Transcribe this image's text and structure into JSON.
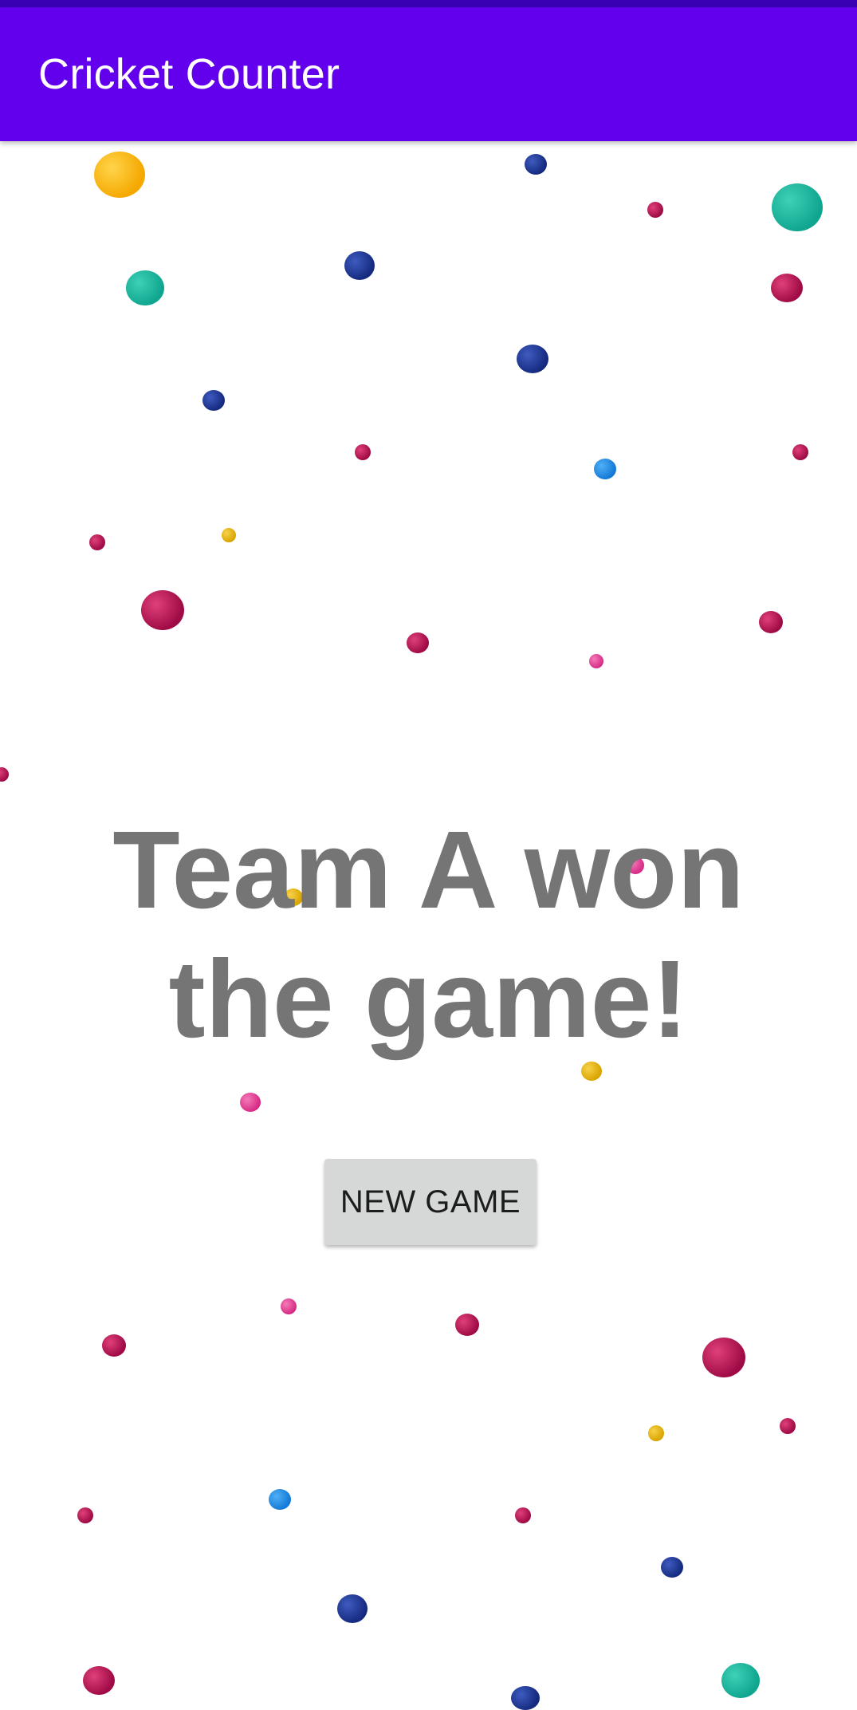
{
  "app_bar": {
    "title": "Cricket Counter",
    "color": "#6200ee",
    "status_bar_color": "#3700b3"
  },
  "main": {
    "winner_message": "Team A won the game!",
    "new_game_label": "NEW GAME",
    "text_color": "#757575",
    "button_color": "#d6d7d7"
  },
  "background": {
    "pattern": "colorful confetti dots",
    "colors": [
      "#f5a800",
      "#0fa58e",
      "#152a7f",
      "#9e0a45",
      "#1479d6",
      "#d62b85",
      "#d9a400"
    ]
  }
}
